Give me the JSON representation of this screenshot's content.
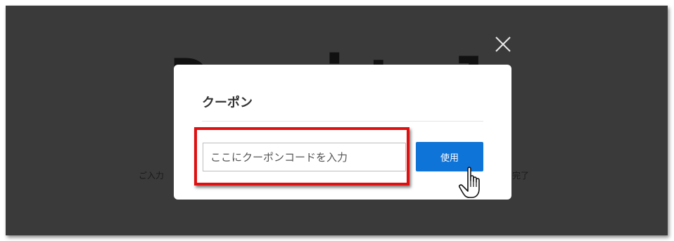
{
  "background": {
    "title": "Do  ital",
    "step_left": "ご入力",
    "step_right": "完了"
  },
  "modal": {
    "title": "クーポン",
    "coupon_input": {
      "placeholder": "ここにクーポンコードを入力",
      "value": ""
    },
    "use_button_label": "使用"
  },
  "icons": {
    "close": "close-icon",
    "cursor": "hand-pointer-cursor-icon"
  },
  "colors": {
    "overlay": "#3a3a3a",
    "accent": "#0f74d8",
    "highlight": "#e01010",
    "modal_bg": "#ffffff"
  }
}
